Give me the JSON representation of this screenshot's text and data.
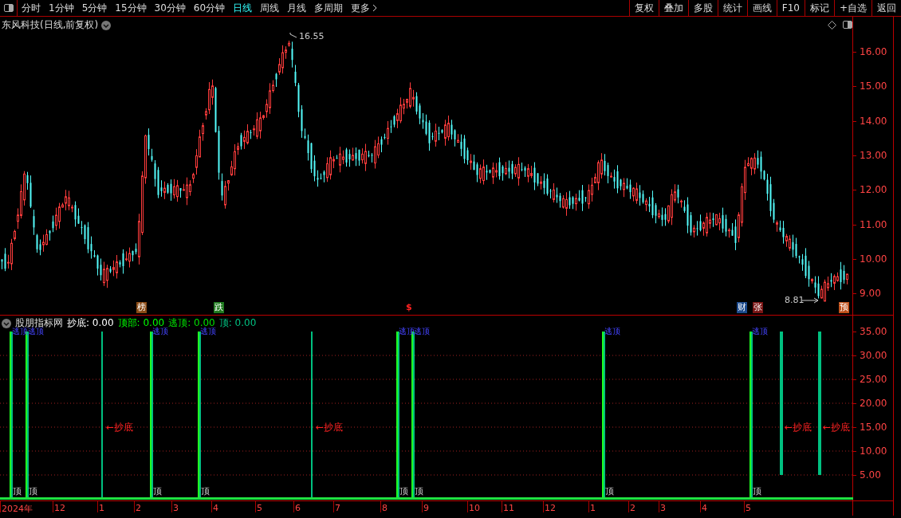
{
  "toolbar": {
    "periods": [
      {
        "label": "分时",
        "selected": false
      },
      {
        "label": "1分钟",
        "selected": false
      },
      {
        "label": "5分钟",
        "selected": false
      },
      {
        "label": "15分钟",
        "selected": false
      },
      {
        "label": "30分钟",
        "selected": false
      },
      {
        "label": "60分钟",
        "selected": false
      },
      {
        "label": "日线",
        "selected": true
      },
      {
        "label": "周线",
        "selected": false
      },
      {
        "label": "月线",
        "selected": false
      },
      {
        "label": "多周期",
        "selected": false
      },
      {
        "label": "更多",
        "selected": false
      }
    ],
    "buttons": [
      "复权",
      "叠加",
      "多股",
      "统计",
      "画线",
      "F10",
      "标记",
      "+自选",
      "返回"
    ]
  },
  "main_chart": {
    "title": "东风科技(日线,前复权)",
    "high_label": "16.55",
    "low_label": "8.81",
    "price_axis": [
      "16.00",
      "15.00",
      "14.00",
      "13.00",
      "12.00",
      "11.00",
      "10.00",
      "9.00"
    ],
    "tags": [
      {
        "label": "榜",
        "color": "#8a4a14"
      },
      {
        "label": "跌",
        "color": "#1e7a1e"
      },
      {
        "label": "$",
        "color": "#000000"
      },
      {
        "label": "财",
        "color": "#1c4a8c"
      },
      {
        "label": "张",
        "color": "#7a1414"
      },
      {
        "label": "预",
        "color": "#c0501a"
      }
    ]
  },
  "indicator": {
    "name": "股朋指标网",
    "readings": [
      {
        "label": "抄底: 0.00",
        "color": "#ffffff"
      },
      {
        "label": "顶部: 0.00",
        "color": "#00ff00"
      },
      {
        "label": "逃顶: 0.00",
        "color": "#00e000"
      },
      {
        "label": "顶: 0.00",
        "color": "#00c080"
      }
    ],
    "axis": [
      "35.00",
      "30.00",
      "25.00",
      "20.00",
      "15.00",
      "10.00",
      "5.00"
    ],
    "signals": [
      {
        "kind": "top",
        "label": "顶",
        "note": "逃顶"
      },
      {
        "kind": "top",
        "label": "顶",
        "note": "逃顶"
      },
      {
        "kind": "bottom",
        "label": "←抄底"
      },
      {
        "kind": "top",
        "label": "顶",
        "note": "逃顶"
      },
      {
        "kind": "top",
        "label": "顶",
        "note": "逃顶"
      },
      {
        "kind": "bottom",
        "label": "←抄底"
      },
      {
        "kind": "top",
        "label": "顶",
        "note": "逃顶"
      },
      {
        "kind": "top",
        "label": "顶",
        "note": "逃顶"
      },
      {
        "kind": "top",
        "label": "顶",
        "note": "逃顶"
      },
      {
        "kind": "top",
        "label": "顶",
        "note": "逃顶"
      },
      {
        "kind": "bottom",
        "label": "←抄底"
      },
      {
        "kind": "bottom",
        "label": "←抄底"
      }
    ]
  },
  "date_axis": [
    "2024年",
    "12",
    "1",
    "2",
    "3",
    "4",
    "5",
    "6",
    "7",
    "8",
    "9",
    "10",
    "11",
    "12",
    "1",
    "2",
    "3",
    "4",
    "5"
  ]
}
